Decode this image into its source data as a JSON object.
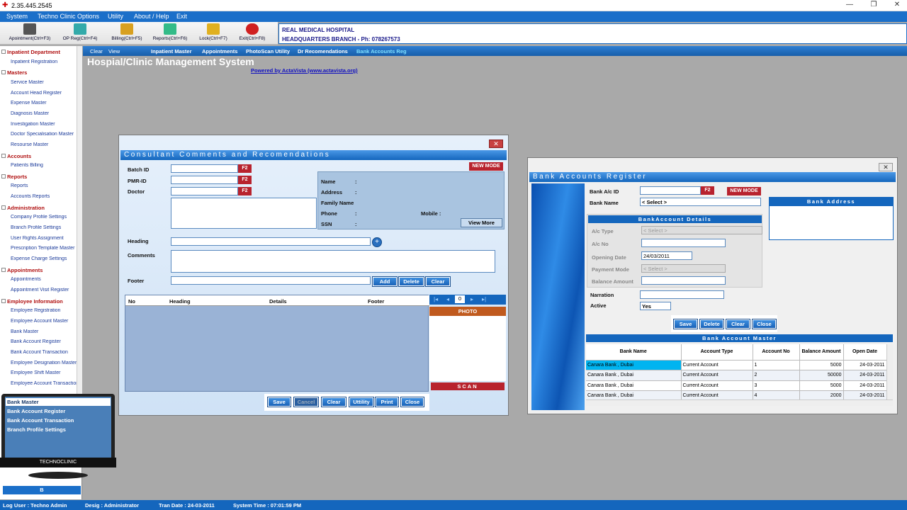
{
  "window": {
    "title": "2.35.445.2545"
  },
  "menu": [
    "System",
    "Techno Clinic Options",
    "Utility",
    "About / Help",
    "Exit"
  ],
  "toolbar": [
    {
      "label": "Apointment(Ctrl+F3)",
      "icon": "appointment-icon",
      "color": "#555"
    },
    {
      "label": "OP Reg(Ctrl+F4)",
      "icon": "op-reg-icon",
      "color": "#3aa"
    },
    {
      "label": "Billing(Ctrl+F5)",
      "icon": "billing-icon",
      "color": "#d8a020"
    },
    {
      "label": "Reports(Ctrl+F6)",
      "icon": "reports-icon",
      "color": "#3b8"
    },
    {
      "label": "Lock(Ctrl+F7)",
      "icon": "lock-icon",
      "color": "#e0b020"
    },
    {
      "label": "Exit(Ctrl+F8)",
      "icon": "exit-icon",
      "color": "#d02020"
    }
  ],
  "hospital": {
    "name": "REAL MEDICAL HOSPITAL",
    "branch": "HEADQUARTERS BRANCH  - Ph: 078267573"
  },
  "nav": {
    "clear": "Clear",
    "view": "View",
    "links": [
      "Inpatient Master",
      "Appointments",
      "PhotoScan Utility",
      "Dr Recomendations",
      "Bank Accounts Reg"
    ]
  },
  "app_title": "Hospial/Clinic Management System",
  "powered": "Powered by ActaVista (www.actavista.org)",
  "sidebar": [
    {
      "t": "cat",
      "label": "Inpatient Department"
    },
    {
      "t": "item",
      "label": "Inpatient Registration"
    },
    {
      "t": "cat",
      "label": "Masters"
    },
    {
      "t": "item",
      "label": "Service Master"
    },
    {
      "t": "item",
      "label": "Account Head Register"
    },
    {
      "t": "item",
      "label": "Expense Master"
    },
    {
      "t": "item",
      "label": "Diagnosis Master"
    },
    {
      "t": "item",
      "label": "Investigation Master"
    },
    {
      "t": "item",
      "label": "Doctor Specialisation Master"
    },
    {
      "t": "item",
      "label": "Resourse Master"
    },
    {
      "t": "cat",
      "label": "Accounts"
    },
    {
      "t": "item",
      "label": "Patients Billing"
    },
    {
      "t": "cat",
      "label": "Reports"
    },
    {
      "t": "item",
      "label": "Reports"
    },
    {
      "t": "item",
      "label": "Accounts Reports"
    },
    {
      "t": "cat",
      "label": "Administration"
    },
    {
      "t": "item",
      "label": "Company Profile Settings"
    },
    {
      "t": "item",
      "label": "Branch Profile Settings"
    },
    {
      "t": "item",
      "label": "User Rights Assignment"
    },
    {
      "t": "item",
      "label": "Prescription Template Master"
    },
    {
      "t": "item",
      "label": "Expense Charge Settings"
    },
    {
      "t": "cat",
      "label": "Appointments"
    },
    {
      "t": "item",
      "label": "Appointments"
    },
    {
      "t": "item",
      "label": "Appointment Visit Register"
    },
    {
      "t": "cat",
      "label": "Employee Information"
    },
    {
      "t": "item",
      "label": "Employee Registration"
    },
    {
      "t": "item",
      "label": "Employee Account Master"
    },
    {
      "t": "item",
      "label": "Bank Master"
    },
    {
      "t": "item",
      "label": "Bank Account Register"
    },
    {
      "t": "item",
      "label": "Bank Account Transaction"
    },
    {
      "t": "item",
      "label": "Employee Designation Master"
    },
    {
      "t": "item",
      "label": "Employee Shift Master"
    },
    {
      "t": "item",
      "label": "Employee Account Transaction"
    }
  ],
  "monitor": {
    "items": [
      "Bank Master",
      "Bank Account Register",
      "Bank Account Transaction",
      "Branch Profile Settings"
    ],
    "brand": "TECHNOCLINIC",
    "bottom_label": "B"
  },
  "consult": {
    "title": "Consultant Comments and Recomendations",
    "new_mode": "NEW MODE",
    "labels": {
      "batch": "Batch ID",
      "pmr": "PMR-ID",
      "doctor": "Doctor",
      "heading": "Heading",
      "comments": "Comments",
      "footer": "Footer"
    },
    "f2": "F2",
    "info": {
      "name": "Name",
      "address": "Address",
      "family": "Family Name",
      "phone": "Phone",
      "mobile": "Mobile :",
      "ssn": "SSN",
      "colon": ":"
    },
    "view_more": "View More",
    "row_btns": [
      "Add",
      "Delete",
      "Clear"
    ],
    "grid_headers": [
      "No",
      "Heading",
      "Details",
      "Footer"
    ],
    "pager_value": "0",
    "photo": "PHOTO",
    "scan": "SCAN",
    "bottom_btns": [
      "Save",
      "Cancel",
      "Clear",
      "Uttility",
      "Print",
      "Close"
    ]
  },
  "bank": {
    "title": "Bank Accounts Register",
    "labels": {
      "ac_id": "Bank A/c ID",
      "bank_name": "Bank Name",
      "details": "BankAccount Details",
      "ac_type": "A/c Type",
      "ac_no": "A/c No",
      "opening": "Opening Date",
      "payment": "Payment Mode",
      "balance": "Balance Amount",
      "narration": "Narration",
      "active": "Active",
      "address": "Bank Address"
    },
    "f2": "F2",
    "new_mode": "NEW MODE",
    "select": "< Select >",
    "opening_date": "24/03/2011",
    "active_value": "Yes",
    "btns": [
      "Save",
      "Delete",
      "Clear",
      "Close"
    ],
    "master_title": "Bank Account Master",
    "columns": [
      "Bank Name",
      "Account Type",
      "Account No",
      "Balance Amount",
      "Open Date"
    ],
    "rows": [
      [
        "Canara Bank , Dubai",
        "Current Account",
        "1",
        "5000",
        "24-03-2011"
      ],
      [
        "Canara Bank , Dubai",
        "Current Account",
        "2",
        "50000",
        "24-03-2011"
      ],
      [
        "Canara Bank , Dubai",
        "Current Account",
        "3",
        "5000",
        "24-03-2011"
      ],
      [
        "Canara Bank , Dubai",
        "Current Account",
        "4",
        "2000",
        "24-03-2011"
      ]
    ]
  },
  "status": {
    "user": "Log User : Techno Admin",
    "desig": "Desig : Administrator",
    "tran": "Tran Date : 24-03-2011",
    "time": "System Time : 07:01:59 PM"
  }
}
